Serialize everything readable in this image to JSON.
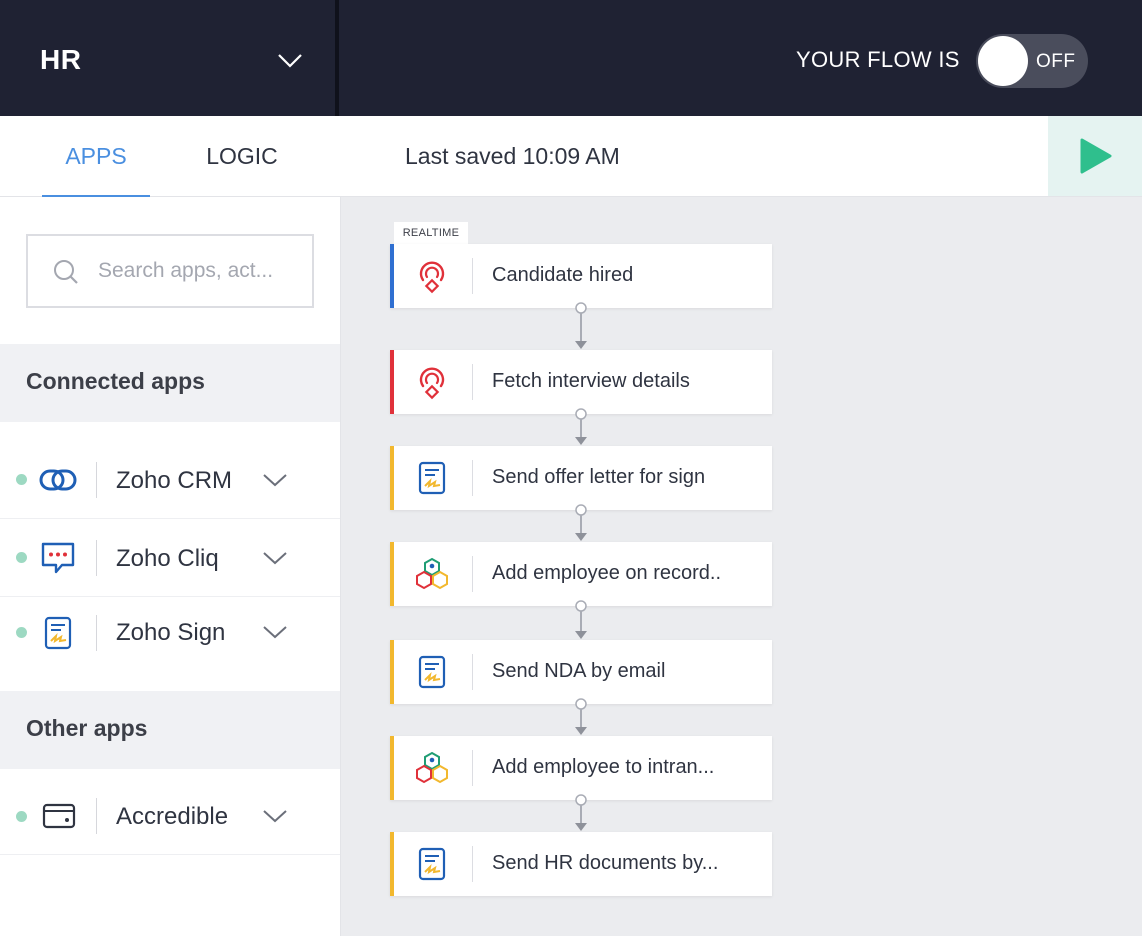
{
  "header": {
    "workspace_name": "HR",
    "flow_status_label": "YOUR FLOW IS",
    "toggle_text": "OFF"
  },
  "tabs": {
    "apps": "APPS",
    "logic": "LOGIC",
    "last_saved": "Last saved 10:09 AM"
  },
  "sidebar": {
    "search_placeholder": "Search apps, act...",
    "connected_title": "Connected apps",
    "connected_apps": [
      {
        "name": "Zoho CRM",
        "icon": "zoho-crm-icon"
      },
      {
        "name": "Zoho Cliq",
        "icon": "zoho-cliq-icon"
      },
      {
        "name": "Zoho Sign",
        "icon": "zoho-sign-icon"
      }
    ],
    "other_title": "Other apps",
    "other_apps": [
      {
        "name": "Accredible",
        "icon": "accredible-icon"
      }
    ]
  },
  "canvas": {
    "trigger_tag": "REALTIME",
    "nodes": [
      {
        "label": "Candidate hired",
        "icon": "zoho-recruit-icon",
        "accent": "#2f6fd1"
      },
      {
        "label": "Fetch interview details",
        "icon": "zoho-recruit-icon",
        "accent": "#e0313a"
      },
      {
        "label": "Send offer letter for sign",
        "icon": "zoho-sign-icon",
        "accent": "#f2b82e"
      },
      {
        "label": "Add employee on record..",
        "icon": "zoho-people-icon",
        "accent": "#f2b82e"
      },
      {
        "label": "Send NDA by email",
        "icon": "zoho-sign-icon",
        "accent": "#f2b82e"
      },
      {
        "label": "Add employee to intran...",
        "icon": "zoho-people-icon",
        "accent": "#f2b82e"
      },
      {
        "label": "Send HR documents by...",
        "icon": "zoho-sign-icon",
        "accent": "#f2b82e"
      }
    ]
  },
  "colors": {
    "header_bg": "#1f2233",
    "accent_blue": "#4a8fe0",
    "run_green": "#2fbf8d",
    "connected_dot": "#9dd9c2"
  }
}
